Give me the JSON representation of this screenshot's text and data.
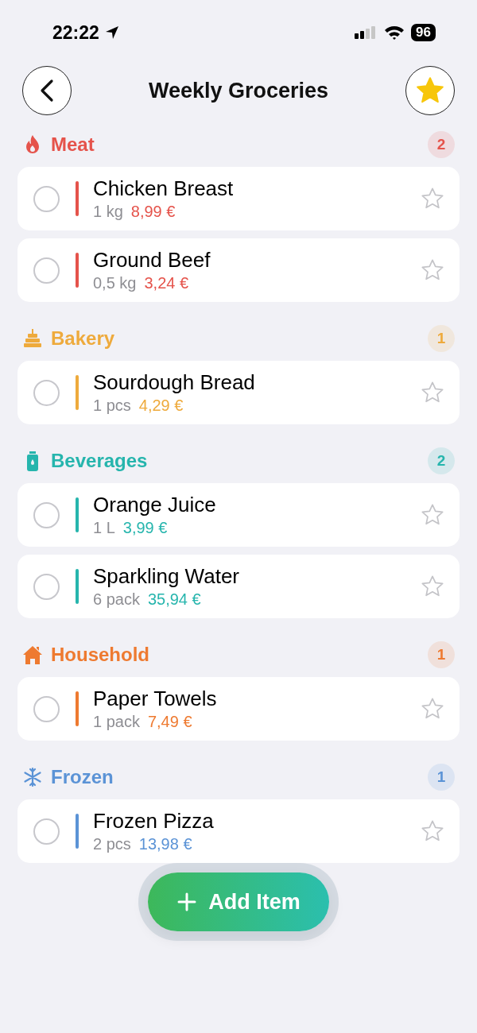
{
  "status_bar": {
    "time": "22:22",
    "battery": "96"
  },
  "header": {
    "title": "Weekly Groceries",
    "starred": true
  },
  "categories": [
    {
      "name": "Meat",
      "kind": "flame",
      "color": "#e5534b",
      "count": "2",
      "items": [
        {
          "name": "Chicken Breast",
          "quantity": "1 kg",
          "price": "8,99 €",
          "checked": false,
          "starred": false
        },
        {
          "name": "Ground Beef",
          "quantity": "0,5 kg",
          "price": "3,24 €",
          "checked": false,
          "starred": false
        }
      ]
    },
    {
      "name": "Bakery",
      "kind": "cake",
      "color": "#eeaa3c",
      "count": "1",
      "items": [
        {
          "name": "Sourdough Bread",
          "quantity": "1 pcs",
          "price": "4,29 €",
          "checked": false,
          "starred": false
        }
      ]
    },
    {
      "name": "Beverages",
      "kind": "bottle",
      "color": "#26b5ad",
      "count": "2",
      "items": [
        {
          "name": "Orange Juice",
          "quantity": "1 L",
          "price": "3,99 €",
          "checked": false,
          "starred": false
        },
        {
          "name": "Sparkling Water",
          "quantity": "6 pack",
          "price": "35,94 €",
          "checked": false,
          "starred": false
        }
      ]
    },
    {
      "name": "Household",
      "kind": "house",
      "color": "#ee7a30",
      "count": "1",
      "items": [
        {
          "name": "Paper Towels",
          "quantity": "1 pack",
          "price": "7,49 €",
          "checked": false,
          "starred": false
        }
      ]
    },
    {
      "name": "Frozen",
      "kind": "snowflake",
      "color": "#5b93d6",
      "count": "1",
      "items": [
        {
          "name": "Frozen Pizza",
          "quantity": "2 pcs",
          "price": "13,98 €",
          "checked": false,
          "starred": false
        }
      ]
    }
  ],
  "add_button": {
    "label": "Add Item"
  }
}
